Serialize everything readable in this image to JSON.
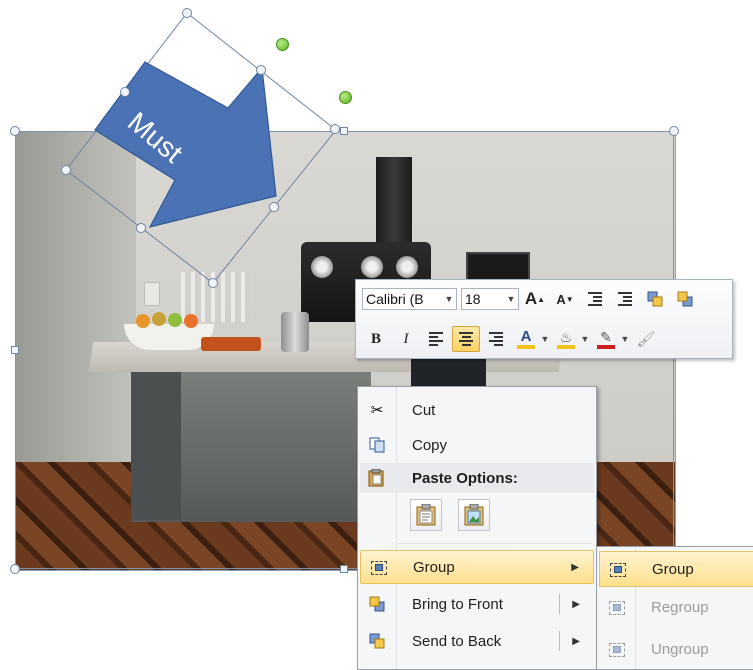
{
  "arrow_shape": {
    "text": "Must",
    "fill": "#4a72b4",
    "stroke": "#2f5a96"
  },
  "mini_toolbar": {
    "font_name": "Calibri (B",
    "font_size": "18",
    "bold": "B",
    "italic": "I",
    "grow_font": "A",
    "shrink_font": "A",
    "font_color_letter": "A",
    "font_color": "#f4c21d",
    "highlight_color": "#f4c21d",
    "line_color": "#d01c1c"
  },
  "context_menu": {
    "cut": "Cut",
    "copy": "Copy",
    "paste_options": "Paste Options:",
    "group": "Group",
    "bring_to_front": "Bring to Front",
    "send_to_back": "Send to Back"
  },
  "submenu": {
    "group": "Group",
    "regroup": "Regroup",
    "ungroup": "Ungroup"
  },
  "colors": {
    "highlight": "#ffe08e",
    "menu_bg": "#f5f6f7",
    "selection": "#7c93b2"
  }
}
